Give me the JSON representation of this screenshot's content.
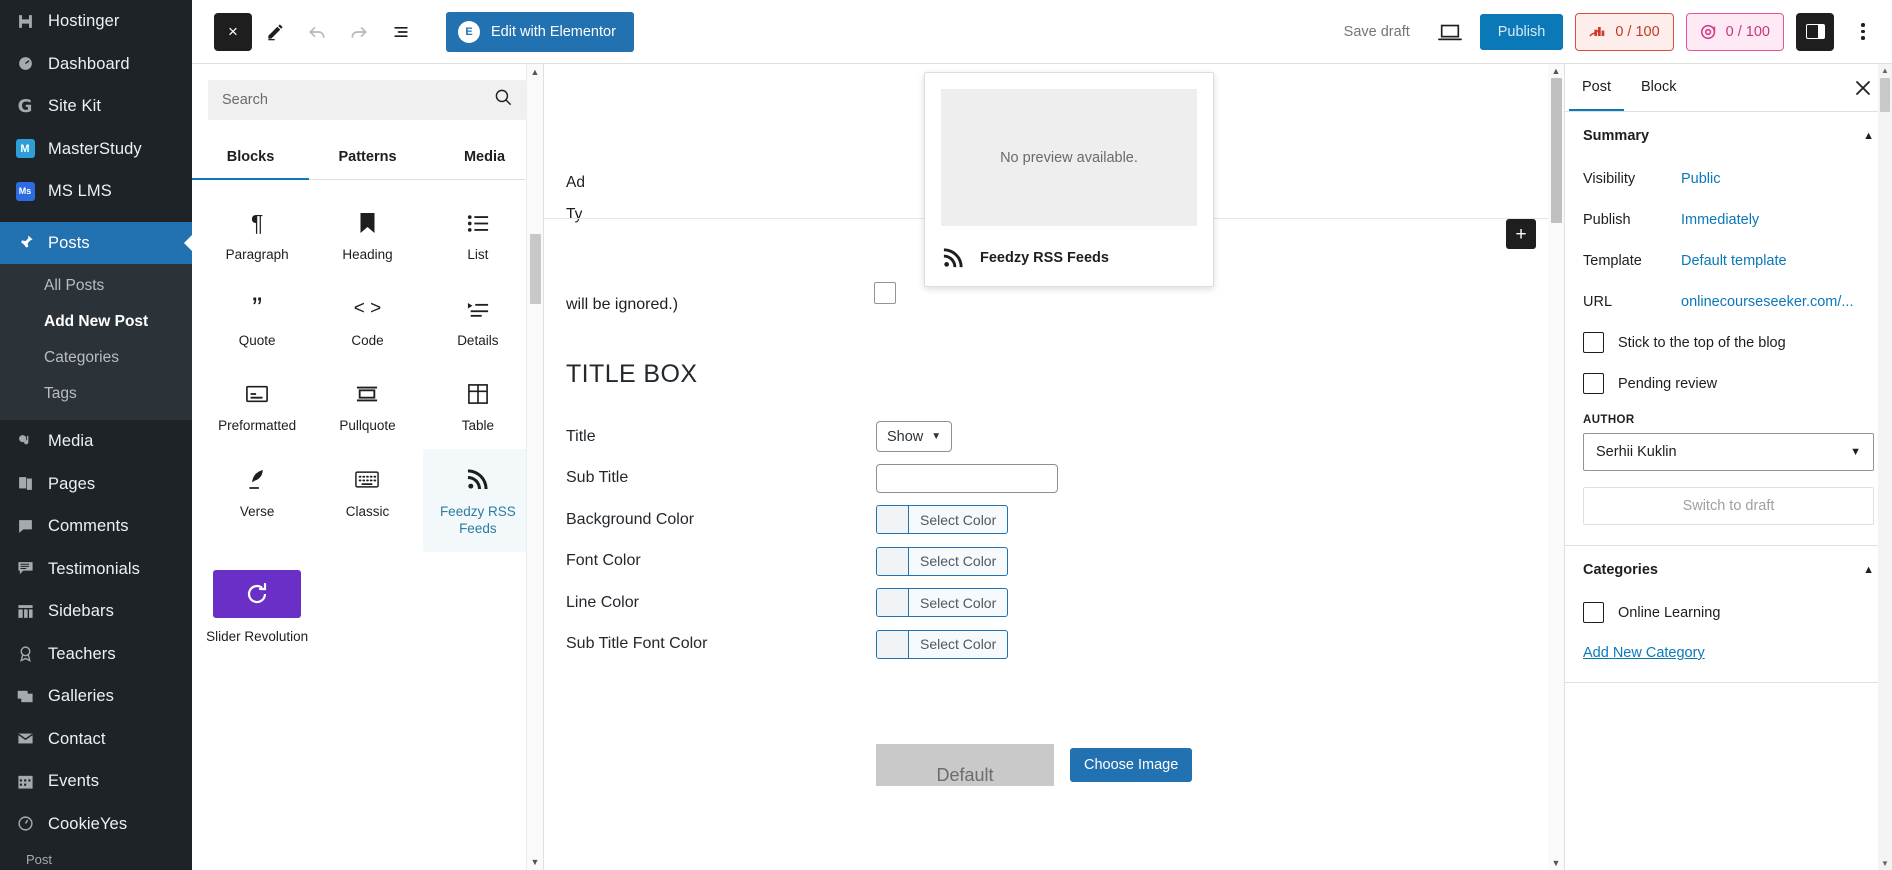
{
  "wp_sidebar": {
    "items": [
      {
        "label": "Hostinger",
        "icon": "hostinger-icon"
      },
      {
        "label": "Dashboard",
        "icon": "dashboard-icon"
      },
      {
        "label": "Site Kit",
        "icon": "site-kit-icon"
      },
      {
        "label": "MasterStudy",
        "icon": "masterstudy-icon"
      },
      {
        "label": "MS LMS",
        "icon": "ms-lms-icon"
      },
      {
        "label": "Posts",
        "icon": "pin-icon",
        "active": true
      },
      {
        "label": "Media",
        "icon": "media-icon"
      },
      {
        "label": "Pages",
        "icon": "pages-icon"
      },
      {
        "label": "Comments",
        "icon": "comment-icon"
      },
      {
        "label": "Testimonials",
        "icon": "testimonial-icon"
      },
      {
        "label": "Sidebars",
        "icon": "sidebars-icon"
      },
      {
        "label": "Teachers",
        "icon": "award-icon"
      },
      {
        "label": "Galleries",
        "icon": "gallery-icon"
      },
      {
        "label": "Contact",
        "icon": "envelope-icon"
      },
      {
        "label": "Events",
        "icon": "calendar-icon"
      },
      {
        "label": "CookieYes",
        "icon": "cookie-icon"
      }
    ],
    "submenu": [
      {
        "label": "All Posts",
        "current": false
      },
      {
        "label": "Add New Post",
        "current": true
      },
      {
        "label": "Categories",
        "current": false
      },
      {
        "label": "Tags",
        "current": false
      }
    ],
    "bottom_label": "Post"
  },
  "toolbar": {
    "close_label": "×",
    "edit_icon": "pencil-icon",
    "undo_icon": "undo-icon",
    "redo_icon": "redo-icon",
    "list_view_icon": "list-view-icon",
    "elementor_label": "Edit with Elementor",
    "elementor_badge": "E",
    "save_draft_label": "Save draft",
    "preview_icon": "preview-device-icon",
    "publish_label": "Publish",
    "seo_score": "0 / 100",
    "seo_icon": "rank-math-seo-icon",
    "ai_score": "0 / 100",
    "ai_icon": "content-ai-icon",
    "sidebar_toggle_icon": "settings-sidebar-icon",
    "options_icon": "more-options-icon"
  },
  "inserter": {
    "search_placeholder": "Search",
    "search_value": "",
    "search_icon": "search-icon",
    "tabs": [
      {
        "label": "Blocks",
        "active": true
      },
      {
        "label": "Patterns",
        "active": false
      },
      {
        "label": "Media",
        "active": false
      }
    ],
    "blocks": [
      {
        "label": "Paragraph",
        "icon": "paragraph-icon",
        "glyph": "¶"
      },
      {
        "label": "Heading",
        "icon": "heading-bookmark-icon",
        "glyph": "🔖"
      },
      {
        "label": "List",
        "icon": "list-icon",
        "glyph": "≣"
      },
      {
        "label": "Quote",
        "icon": "quote-icon",
        "glyph": "”"
      },
      {
        "label": "Code",
        "icon": "code-icon",
        "glyph": "‹›"
      },
      {
        "label": "Details",
        "icon": "details-icon",
        "glyph": "≣"
      },
      {
        "label": "Preformatted",
        "icon": "preformatted-icon",
        "glyph": "▤"
      },
      {
        "label": "Pullquote",
        "icon": "pullquote-icon",
        "glyph": "▭"
      },
      {
        "label": "Table",
        "icon": "table-icon",
        "glyph": "▦"
      },
      {
        "label": "Verse",
        "icon": "verse-feather-icon",
        "glyph": "✎"
      },
      {
        "label": "Classic",
        "icon": "classic-keyboard-icon",
        "glyph": "⌨"
      },
      {
        "label": "Feedzy RSS Feeds",
        "icon": "rss-icon",
        "glyph": "⦿",
        "selected": true
      },
      {
        "label": "Slider Revolution",
        "icon": "slider-revolution-icon",
        "glyph": "⟳",
        "purple": true
      }
    ]
  },
  "popover": {
    "preview_text": "No preview available.",
    "block_name": "Feedzy RSS Feeds",
    "block_icon": "rss-icon"
  },
  "canvas": {
    "meta_tail_lines": [
      "Ad",
      "Ty"
    ],
    "ignored_text": "will be ignored.)",
    "section_title": "TITLE BOX",
    "add_block_label": "+",
    "fields": [
      {
        "label": "Title",
        "control": "select",
        "value": "Show"
      },
      {
        "label": "Sub Title",
        "control": "text",
        "value": ""
      },
      {
        "label": "Background Color",
        "control": "color",
        "value": "Select Color"
      },
      {
        "label": "Font Color",
        "control": "color",
        "value": "Select Color"
      },
      {
        "label": "Line Color",
        "control": "color",
        "value": "Select Color"
      },
      {
        "label": "Sub Title Font Color",
        "control": "color",
        "value": "Select Color"
      }
    ],
    "image_default_label": "Default",
    "choose_image_label": "Choose Image"
  },
  "settings": {
    "tabs": [
      {
        "label": "Post",
        "active": true
      },
      {
        "label": "Block",
        "active": false
      }
    ],
    "close_icon": "close-icon",
    "summary": {
      "title": "Summary",
      "rows": [
        {
          "key": "Visibility",
          "value": "Public"
        },
        {
          "key": "Publish",
          "value": "Immediately"
        },
        {
          "key": "Template",
          "value": "Default template"
        },
        {
          "key": "URL",
          "value": "onlinecourseseeker.com/..."
        }
      ],
      "checkboxes": [
        {
          "label": "Stick to the top of the blog",
          "checked": false
        },
        {
          "label": "Pending review",
          "checked": false
        }
      ],
      "author_label": "AUTHOR",
      "author_value": "Serhii Kuklin",
      "switch_draft_label": "Switch to draft"
    },
    "categories": {
      "title": "Categories",
      "items": [
        {
          "label": "Online Learning",
          "checked": false
        }
      ],
      "add_new_label": "Add New Category"
    }
  },
  "colors": {
    "wp_sidebar_bg": "#1d2327",
    "wp_active_blue": "#2271b1",
    "accent_blue": "#0b78b8",
    "seo_red": "#c0392b",
    "ai_pink": "#c7357e",
    "slider_purple": "#6a2fc7"
  }
}
